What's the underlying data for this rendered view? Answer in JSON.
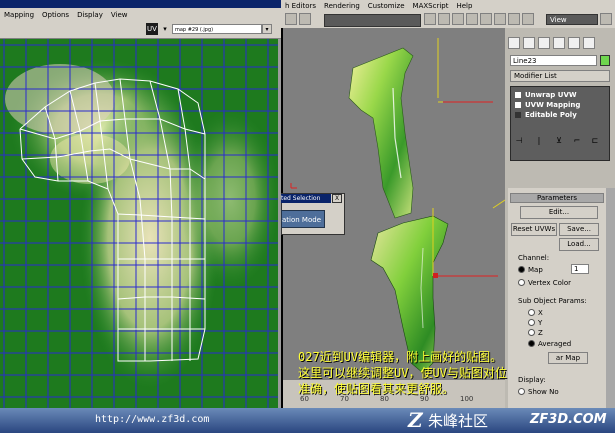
{
  "uv_editor": {
    "menu": [
      "Mapping",
      "Options",
      "Display",
      "View"
    ],
    "map_select": "map #29 (.jpg)",
    "dropdown_arrow": "▾",
    "tool_a": "UV",
    "tool_b": "▾"
  },
  "max": {
    "menu": [
      "h Editors",
      "Rendering",
      "Customize",
      "MAXScript",
      "Help"
    ],
    "viewport_dropdown": "View"
  },
  "command_panel": {
    "object_name": "Line23",
    "modifier_list": "Modifier List",
    "stack": [
      "Unwrap UVW",
      "UVW Mapping",
      "Editable Poly"
    ],
    "stack_tools": [
      "⊣",
      "|",
      "⊻",
      "⌐",
      "⊏"
    ],
    "rollout_title": "Parameters",
    "edit_button": "Edit...",
    "reset_uvws": "Reset UVWs",
    "save_button": "Save...",
    "load_button": "Load...",
    "channel_label": "Channel:",
    "map_radio": "Map",
    "map_channel_value": "1",
    "vertex_color_radio": "Vertex Color",
    "sub_object_label": "Sub Object Params:",
    "axis_x": "X",
    "axis_y": "Y",
    "axis_z": "Z",
    "averaged": "Averaged",
    "display_label": "Display:",
    "show_no": "Show No",
    "map_button_partial": "ar Map"
  },
  "floating_dialog": {
    "title": "ted Selection",
    "close": "X",
    "button": "ation Mode"
  },
  "timeline": {
    "ticks": [
      "60",
      "70",
      "80",
      "90",
      "100"
    ]
  },
  "caption": {
    "lines": [
      "027近到UV编辑器，附上画好的贴图。",
      "这里可以继续调整UV，使UV与贴图对位",
      "准确，使贴图看其来更舒服。"
    ]
  },
  "footer": {
    "url": "http://www.zf3d.com",
    "logo_letter": "Z",
    "site_cn": "朱峰社区",
    "site_en": "ZF3D.COM"
  },
  "colors": {
    "uv_background": "#1e7a1e",
    "uv_grid": "#2a2ad0",
    "viewport_bg": "#7f7f7f",
    "caption": "#ffff33",
    "object_color": "#6fd64f"
  }
}
